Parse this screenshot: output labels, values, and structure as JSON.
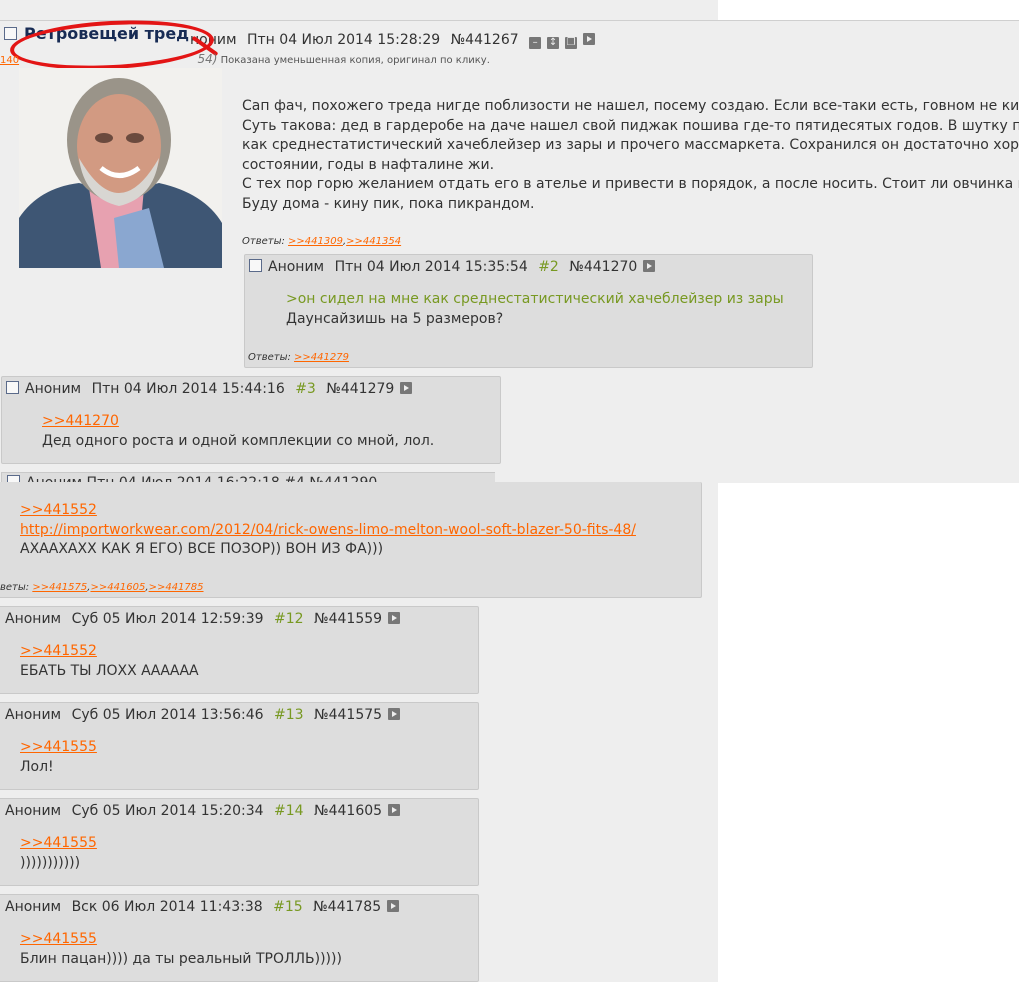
{
  "op": {
    "title": "Ретровещей тред",
    "author_tail": "ноним",
    "date": "Птн 04 Июл 2014 15:28:29",
    "number": "№441267",
    "file_info_prefix": "140",
    "file_info_suffix": "54)",
    "file_note": "Показана уменьшенная копия, оригинал по клику.",
    "body_lines": [
      "Сап фач, похожего треда нигде поблизости не нашел, посему создаю. Если все-таки есть, говном не кид",
      "Суть такова: дед в гардеробе на даче нашел свой пиджак пошива где-то пятидесятых годов. В шутку пре",
      "как среднестатистический хачеблейзер из зары и прочего массмаркета. Сохранился он достаточно хоро",
      "состоянии, годы в нафталине жи.",
      "С тех пор горю желанием отдать его в ателье и привести в порядок, а после носить. Стоит ли овчинка в",
      "Буду дома - кину пик, пока пикрандом."
    ],
    "replies_label": "Ответы:",
    "replies": [
      ">>441309",
      ">>441354"
    ]
  },
  "post2": {
    "author": "Аноним",
    "date": "Птн 04 Июл 2014 15:35:54",
    "index": "#2",
    "number": "№441270",
    "quote": ">он сидел на мне как среднестатистический хачеблейзер из зары",
    "text": "Даунсайзишь на 5 размеров?",
    "replies_label": "Ответы:",
    "replies": [
      ">>441279"
    ]
  },
  "post3": {
    "author": "Аноним",
    "date": "Птн 04 Июл 2014 15:44:16",
    "index": "#3",
    "number": "№441279",
    "link": ">>441270",
    "text": "Дед одного роста и одной комплекции со мной, лол."
  },
  "post4_cut": {
    "text": "Аноним  Птн 04 Июл 2014 16:22:18  #4  №441290"
  },
  "post_mid": {
    "link": ">>441552",
    "url": "http://importworkwear.com/2012/04/rick-owens-limo-melton-wool-soft-blazer-50-fits-48/",
    "text": "АХААХАХХ КАК Я ЕГО) ВСЕ ПОЗОР)) ВОН ИЗ ФА)))",
    "replies_label": "веты:",
    "replies": [
      ">>441575",
      ">>441605",
      ">>441785"
    ]
  },
  "post12": {
    "author": "Аноним",
    "date": "Суб 05 Июл 2014 12:59:39",
    "index": "#12",
    "number": "№441559",
    "link": ">>441552",
    "text": "ЕБАТЬ ТЫ ЛОХХ АААААА"
  },
  "post13": {
    "author": "Аноним",
    "date": "Суб 05 Июл 2014 13:56:46",
    "index": "#13",
    "number": "№441575",
    "link": ">>441555",
    "text": "Лол!"
  },
  "post14": {
    "author": "Аноним",
    "date": "Суб 05 Июл 2014 15:20:34",
    "index": "#14",
    "number": "№441605",
    "link": ">>441555",
    "text": ")))))))))))"
  },
  "post15": {
    "author": "Аноним",
    "date": "Вск 06 Июл 2014 11:43:38",
    "index": "#15",
    "number": "№441785",
    "link": ">>441555",
    "text": "Блин пацан)))) да ты реальный ТРОЛЛЬ)))))"
  },
  "colors": {
    "background": "#eeeeee",
    "post_bg": "#dddddd",
    "link": "#ff6600",
    "greentext": "#789922",
    "title": "#172b54",
    "annotation": "#e31515"
  }
}
